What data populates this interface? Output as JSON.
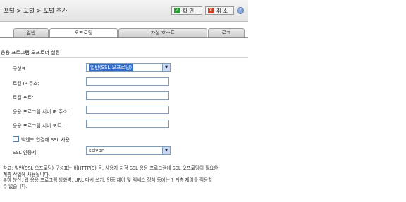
{
  "header": {
    "breadcrumb": "포털 > 포털 > 포털 추가",
    "ok_label": "확 인",
    "cancel_label": "취 소",
    "help_symbol": "?"
  },
  "tabs": [
    {
      "label": "일반",
      "active": false
    },
    {
      "label": "오프로딩",
      "active": true
    },
    {
      "label": "가상 호스트",
      "active": false
    },
    {
      "label": "로고",
      "active": false
    }
  ],
  "section_title": "응용 프로그램 오프로더 설정",
  "form": {
    "scheme_label": "구성표:",
    "scheme_value": "일반(SSL 오프로딩)",
    "local_ip_label": "로컬 IP 주소:",
    "local_ip_value": "",
    "local_port_label": "로컬 포트:",
    "local_port_value": "",
    "app_server_ip_label": "응용 프로그램 서버 IP 주소:",
    "app_server_ip_value": "",
    "app_server_port_label": "응용 프로그램 서버 포트:",
    "app_server_port_value": "",
    "backend_ssl_label": "백엔드 연결에 SSL 사용",
    "backend_ssl_checked": false,
    "ssl_cert_label": "SSL 인증서:",
    "ssl_cert_value": "sslvpn"
  },
  "note": {
    "line1": "참고: 일반(SSL 오프로딩) 구성표는 비HTTP(S) 등, 사용자 지정 SSL 응용 프로그램에 SSL 오프로딩이 필요한",
    "line2": "계층 작업에 사용됩니다.",
    "line3": "부하 분산, 웹 응용 프로그램 방화벽, URL 다시 쓰기, 인증 제어 및 액세스 정책 등에는 ? 계층 제어를 적용할",
    "line4": "수 없습니다."
  },
  "colors": {
    "accent": "#316ac5",
    "ok_icon": "#2f9a3a",
    "cancel_icon": "#d23a2a",
    "input_border": "#7f9db9"
  }
}
